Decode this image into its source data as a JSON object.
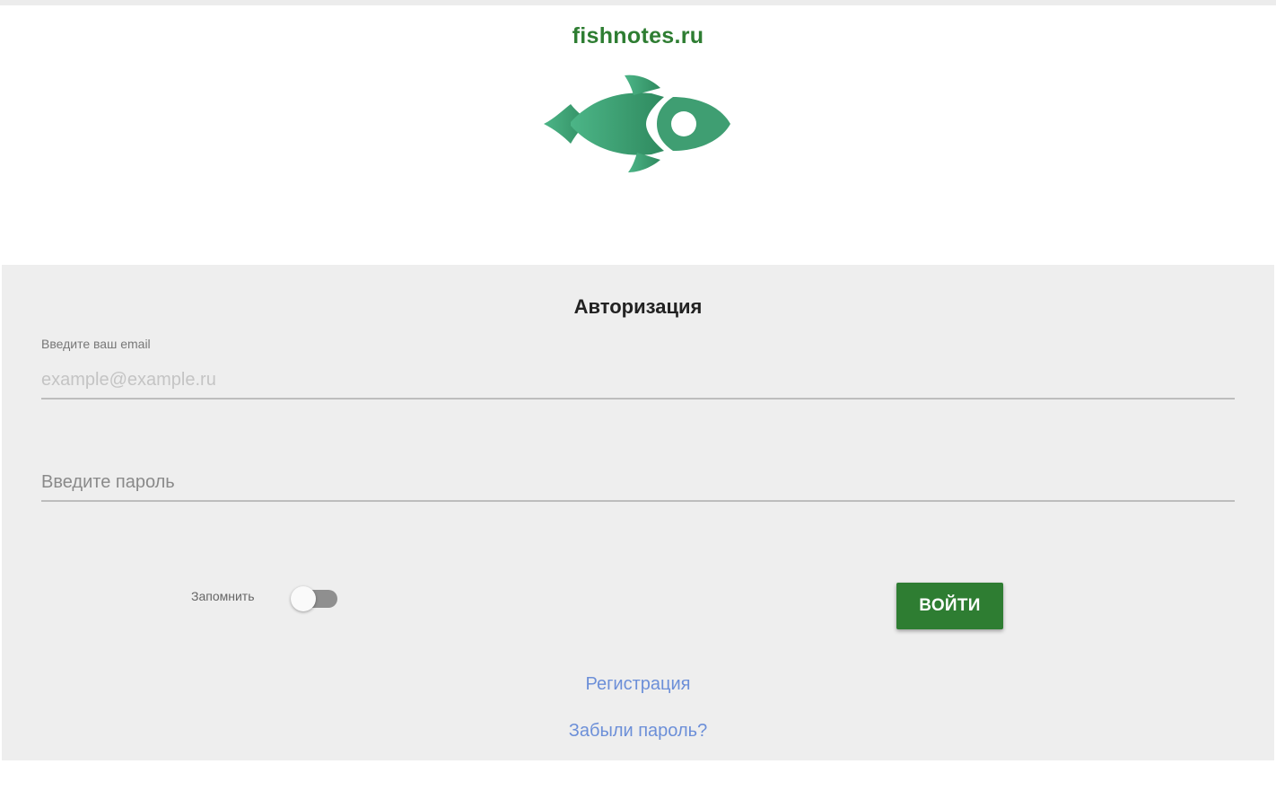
{
  "header": {
    "site_title": "fishnotes.ru",
    "logo_icon": "fish-icon",
    "brand_color": "#2e7d32",
    "logo_color": "#3a9b6e"
  },
  "auth": {
    "title": "Авторизация",
    "email": {
      "label": "Введите ваш email",
      "placeholder": "example@example.ru",
      "value": ""
    },
    "password": {
      "placeholder": "Введите пароль",
      "value": ""
    },
    "remember": {
      "label": "Запомнить",
      "checked": false
    },
    "login_button": "ВОЙТИ",
    "register_link": "Регистрация",
    "forgot_link": "Забыли пароль?",
    "link_color": "#6c8fd8"
  }
}
